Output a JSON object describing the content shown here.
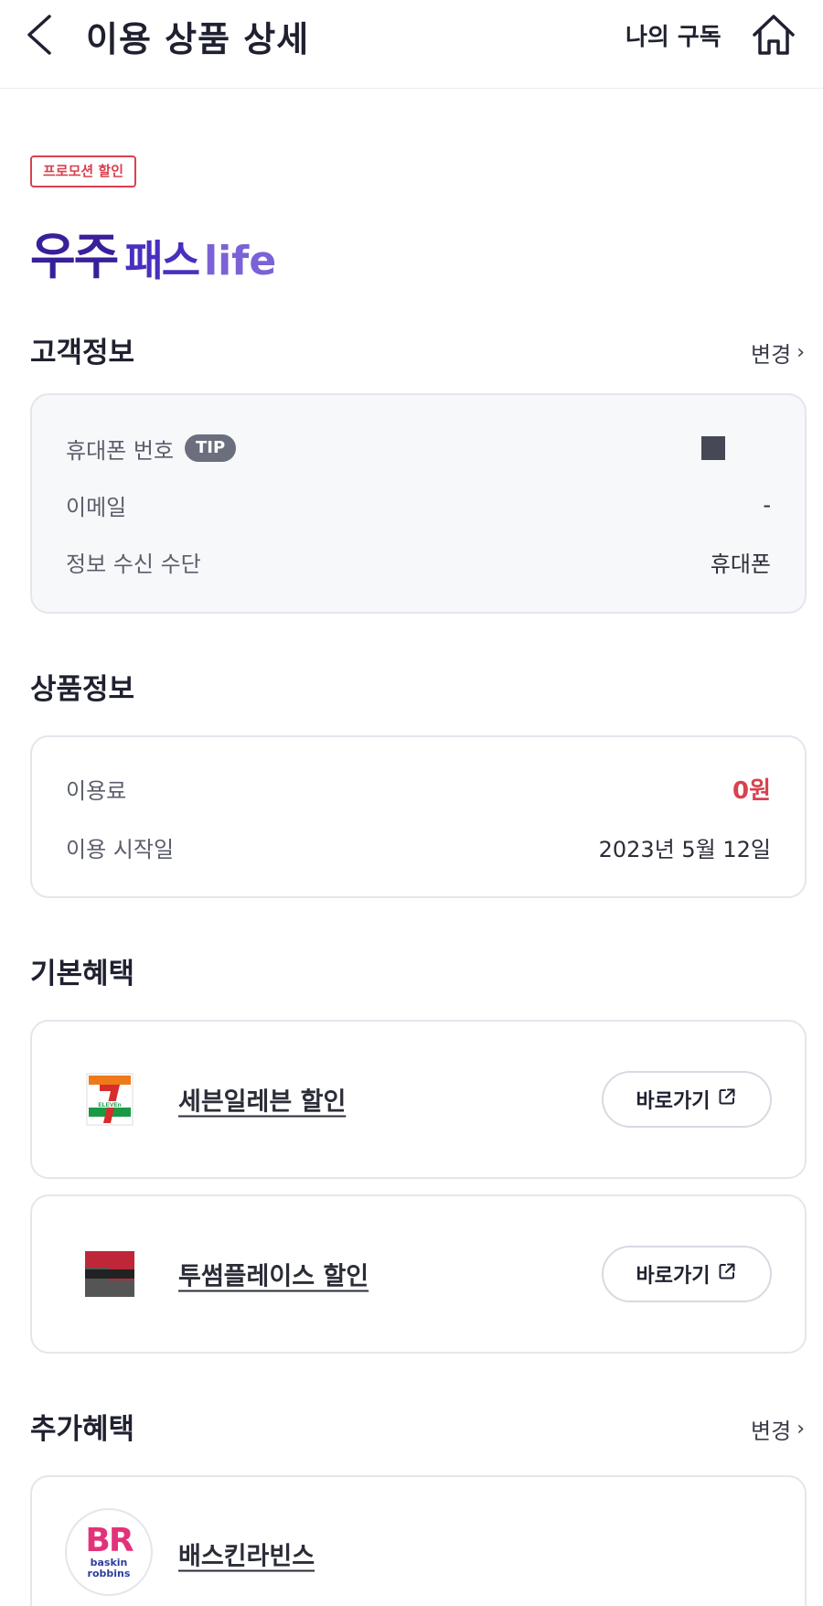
{
  "header": {
    "title": "이용 상품 상세",
    "my_subscription": "나의 구독"
  },
  "product": {
    "promo_badge": "프로모션 할인",
    "logo_a": "우주",
    "logo_b": "패스",
    "logo_c": "life"
  },
  "customer": {
    "section_title": "고객정보",
    "change_label": "변경",
    "rows": [
      {
        "label": "휴대폰 번호",
        "badge": "TIP",
        "value": ""
      },
      {
        "label": "이메일",
        "value": "-"
      },
      {
        "label": "정보 수신 수단",
        "value": "휴대폰"
      }
    ]
  },
  "product_info": {
    "section_title": "상품정보",
    "rows": [
      {
        "label": "이용료",
        "value": "0원"
      },
      {
        "label": "이용 시작일",
        "value": "2023년 5월 12일"
      }
    ]
  },
  "basic_benefits": {
    "section_title": "기본혜택",
    "items": [
      {
        "name": "세븐일레븐 할인",
        "button": "바로가기",
        "icon": "seven-eleven-logo-icon"
      },
      {
        "name": "투썸플레이스 할인",
        "button": "바로가기",
        "icon": "twosome-place-logo-icon"
      }
    ]
  },
  "extra_benefits": {
    "section_title": "추가혜택",
    "change_label": "변경",
    "items": [
      {
        "name": "배스킨라빈스",
        "icon": "baskin-robbins-logo-icon",
        "logo_text": "BR",
        "logo_sub_1": "baskin",
        "logo_sub_2": "robbins"
      }
    ]
  },
  "colors": {
    "accent_red": "#d9414f",
    "brand_purple": "#4a2fbf",
    "text_dark": "#1f2130",
    "card_border": "#e4e6ec"
  }
}
